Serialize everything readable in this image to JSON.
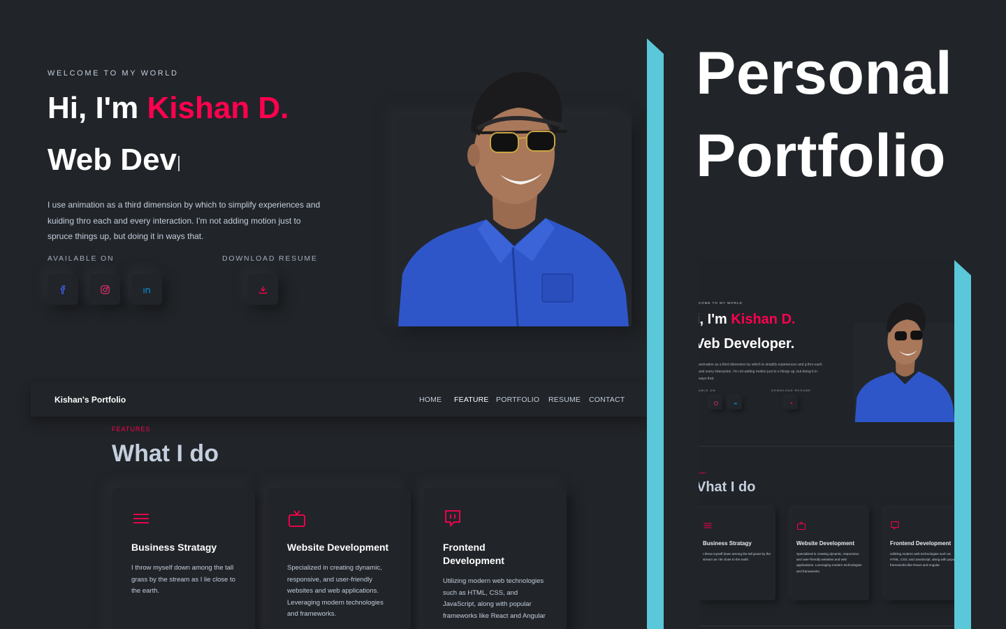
{
  "colors": {
    "background": "#212428",
    "accent": "#ff014f",
    "text": "#c4cfde",
    "panel_stripe": "#5ac8d8"
  },
  "hero": {
    "welcome": "WELCOME TO MY WORLD",
    "greeting": "Hi, I'm ",
    "name": "Kishan D.",
    "role": "Web Dev",
    "description": "I use animation as a third dimension by which to simplify experiences and kuiding thro each and every interaction. I'm not adding motion just to spruce things up, but doing it in ways that.",
    "available_label": "AVAILABLE ON",
    "resume_label": "DOWNLOAD RESUME",
    "social_icons": [
      "facebook-icon",
      "instagram-icon",
      "linkedin-icon"
    ],
    "resume_icon": "download-icon"
  },
  "navbar": {
    "brand": "Kishan's Portfolio",
    "items": [
      "HOME",
      "FEATURE",
      "PORTFOLIO",
      "RESUME",
      "CONTACT"
    ],
    "active": "FEATURE"
  },
  "features": {
    "subtitle": "FEATURES",
    "title": "What I do",
    "cards": [
      {
        "icon": "menu-icon",
        "title": "Business Stratagy",
        "desc": "I throw myself down among the tall grass by the stream as I lie close to the earth."
      },
      {
        "icon": "tv-icon",
        "title": "Website Development",
        "desc": "Specialized in creating dynamic, responsive, and user-friendly websites and web applications. Leveraging modern technologies and frameworks."
      },
      {
        "icon": "chat-icon",
        "title": "Frontend Development",
        "desc": "Utilizing modern web technologies such as HTML, CSS, and JavaScript, along with popular frameworks like React and Angular"
      }
    ]
  },
  "right_panel": {
    "title_line1": "Personal",
    "title_line2": "Portfolio",
    "preview": {
      "welcome": "COME TO MY WORLD",
      "greeting": "i, I'm ",
      "name": "Kishan D.",
      "role": "Veb Developer.",
      "description": "animation as a third dimension by which to simplify experiences and g thro each and every interaction. I'm not adding motion just to e things up, but doing it in ways that.",
      "available_label": "ABLE ON",
      "resume_label": "DOWNLOAD RESUME",
      "features_subtitle": "URES",
      "features_title": "Vhat I do",
      "cards": [
        {
          "title": "Business Stratagy",
          "desc": "I throw myself down among the tall grass by the stream as I lie close to the earth."
        },
        {
          "title": "Website Development",
          "desc": "Specialized in creating dynamic, responsive, and user-friendly websites and web applications. Leveraging modern technologies and frameworks."
        },
        {
          "title": "Frontend Development",
          "desc": "Utilizing modern web technologies such as HTML, CSS, and JavaScript, along with popular frameworks like React and Angular"
        }
      ]
    }
  }
}
